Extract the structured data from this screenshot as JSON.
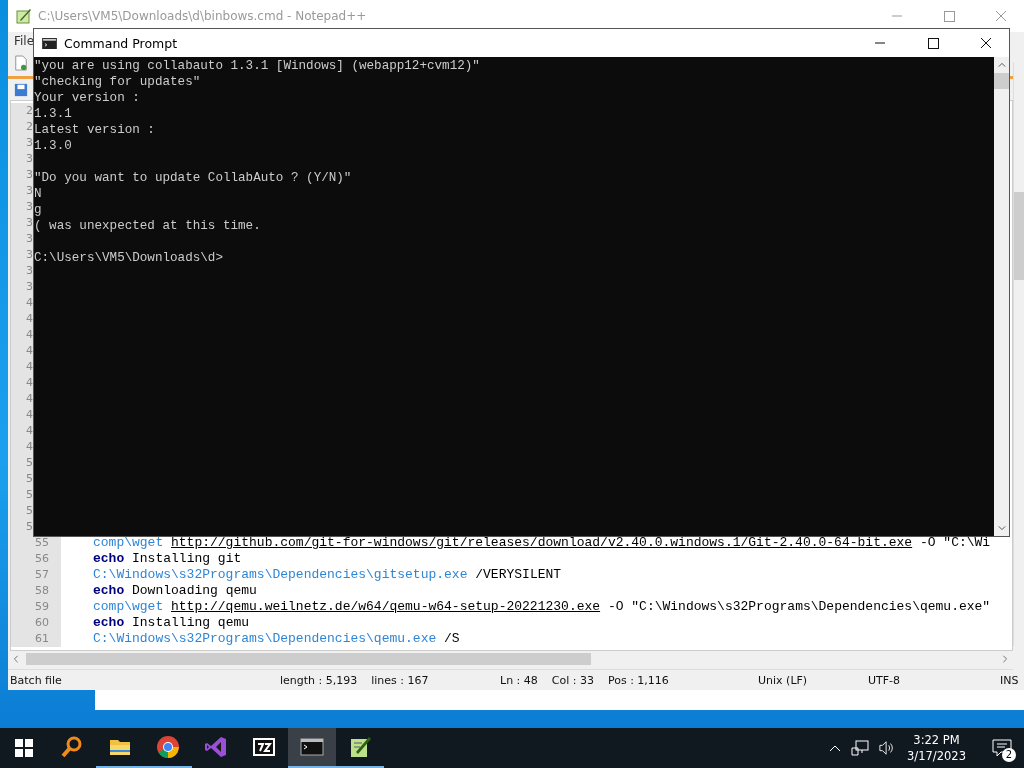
{
  "notepad": {
    "title": "C:\\Users\\VM5\\Downloads\\d\\binbows.cmd - Notepad++",
    "menu": [
      "File"
    ],
    "gutter_fragments": [
      "2",
      "2",
      "3",
      "3",
      "3",
      "3",
      "3",
      "3",
      "3",
      "3",
      "3",
      "3",
      "4",
      "4",
      "4",
      "4",
      "4",
      "4",
      "4",
      "4",
      "4",
      "4",
      "5",
      "5",
      "5",
      "5",
      "5"
    ],
    "code_lines": [
      {
        "number": "55",
        "segments": [
          {
            "kind": "path",
            "text": "comp\\wget "
          },
          {
            "kind": "url",
            "text": "http://github.com/git-for-windows/git/releases/download/v2.40.0.windows.1/Git-2.40.0-64-bit.exe"
          },
          {
            "kind": "text",
            "text": " -O \"C:\\Wi"
          }
        ]
      },
      {
        "number": "56",
        "segments": [
          {
            "kind": "keyword",
            "text": "echo"
          },
          {
            "kind": "text",
            "text": " Installing git"
          }
        ]
      },
      {
        "number": "57",
        "segments": [
          {
            "kind": "path",
            "text": "C:\\Windows\\s32Programs\\Dependencies\\gitsetup.exe"
          },
          {
            "kind": "text",
            "text": " /VERYSILENT"
          }
        ]
      },
      {
        "number": "58",
        "segments": [
          {
            "kind": "keyword",
            "text": "echo"
          },
          {
            "kind": "text",
            "text": " Downloading qemu"
          }
        ]
      },
      {
        "number": "59",
        "segments": [
          {
            "kind": "path",
            "text": "comp\\wget "
          },
          {
            "kind": "url",
            "text": "http://qemu.weilnetz.de/w64/qemu-w64-setup-20221230.exe"
          },
          {
            "kind": "text",
            "text": " -O \"C:\\Windows\\s32Programs\\Dependencies\\qemu.exe\""
          }
        ]
      },
      {
        "number": "60",
        "segments": [
          {
            "kind": "keyword",
            "text": "echo"
          },
          {
            "kind": "text",
            "text": " Installing qemu"
          }
        ]
      },
      {
        "number": "61",
        "segments": [
          {
            "kind": "path",
            "text": "C:\\Windows\\s32Programs\\Dependencies\\qemu.exe"
          },
          {
            "kind": "text",
            "text": " /S"
          }
        ]
      }
    ],
    "status_bar": [
      "Batch file",
      "length : 5,193    lines : 167",
      "Ln : 48    Col : 33    Pos : 1,116",
      "Unix (LF)",
      "UTF-8",
      "INS"
    ]
  },
  "command_prompt": {
    "title": "Command Prompt",
    "blocks": [
      [
        "\"you are using collabauto 1.3.1 [Windows] (webapp12+cvm12)\"",
        "\"checking for updates\"",
        "Your version :",
        "1.3.1",
        "Latest version :",
        "1.3.0"
      ],
      [
        "\"Do you want to update CollabAuto ? (Y/N)\"",
        "N",
        "g",
        "( was unexpected at this time."
      ],
      [
        "C:\\Users\\VM5\\Downloads\\d>"
      ]
    ]
  },
  "taskbar": {
    "apps": [
      {
        "kind": "search",
        "running": false,
        "active": false
      },
      {
        "kind": "folder",
        "running": true,
        "active": false
      },
      {
        "kind": "chrome",
        "running": true,
        "active": false
      },
      {
        "kind": "studio",
        "running": false,
        "active": false
      },
      {
        "kind": "archive",
        "running": false,
        "active": false
      },
      {
        "kind": "console",
        "running": true,
        "active": true
      },
      {
        "kind": "notepad",
        "running": true,
        "active": false
      }
    ],
    "time": "3:22 PM",
    "date": "3/17/2023",
    "notifications": "2"
  }
}
